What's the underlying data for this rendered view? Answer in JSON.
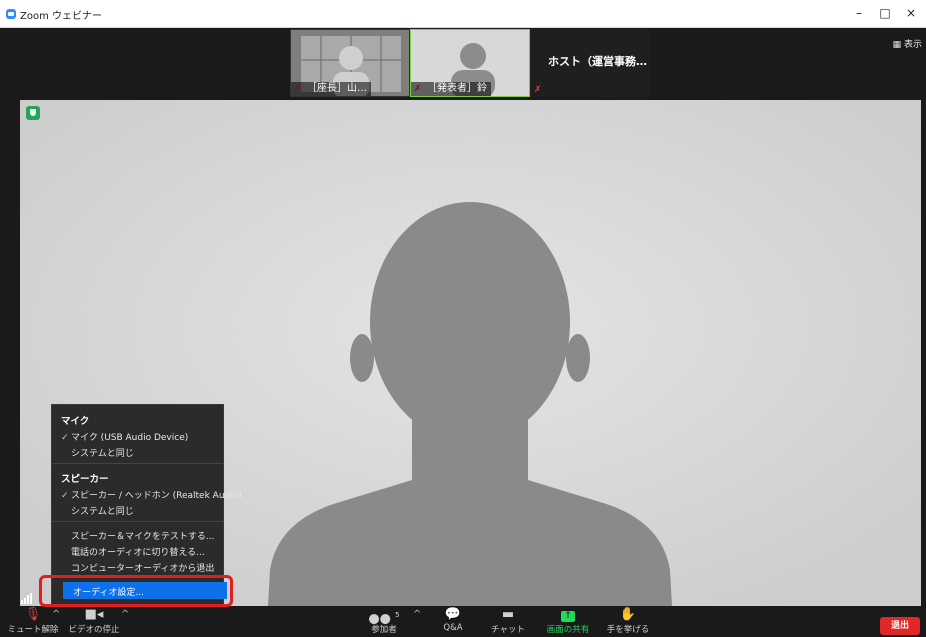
{
  "window": {
    "title": "Zoom ウェビナー",
    "controls": [
      "–",
      "□",
      "×"
    ]
  },
  "top_strip": {
    "view_button": "表示",
    "thumbnails": [
      {
        "label": "［座長］山…"
      },
      {
        "label": "［発表者］鈴"
      }
    ],
    "host_tile": {
      "name": "ホスト（運営事務…"
    }
  },
  "audio_menu": {
    "mic_header": "マイク",
    "mic_items": [
      {
        "label": "マイク (USB Audio Device)",
        "checked": true
      },
      {
        "label": "システムと同じ",
        "checked": false
      }
    ],
    "speaker_header": "スピーカー",
    "speaker_items": [
      {
        "label": "スピーカー / ヘッドホン (Realtek Audio)",
        "checked": true
      },
      {
        "label": "システムと同じ",
        "checked": false
      }
    ],
    "actions": [
      "スピーカー＆マイクをテストする...",
      "電話のオーディオに切り替える...",
      "コンピューターオーディオから退出"
    ],
    "selected_item": "オーディオ設定..."
  },
  "toolbar": {
    "unmute": "ミュート解除",
    "stop_video": "ビデオの停止",
    "participants": "参加者",
    "participants_count": "5",
    "qa": "Q&A",
    "chat": "チャット",
    "share_screen": "画面の共有",
    "raise_hand": "手を挙げる",
    "leave": "退出"
  },
  "colors": {
    "accent_blue": "#0e71eb",
    "leave_red": "#e02828",
    "share_green": "#23d959",
    "highlight_red": "#e02020"
  }
}
